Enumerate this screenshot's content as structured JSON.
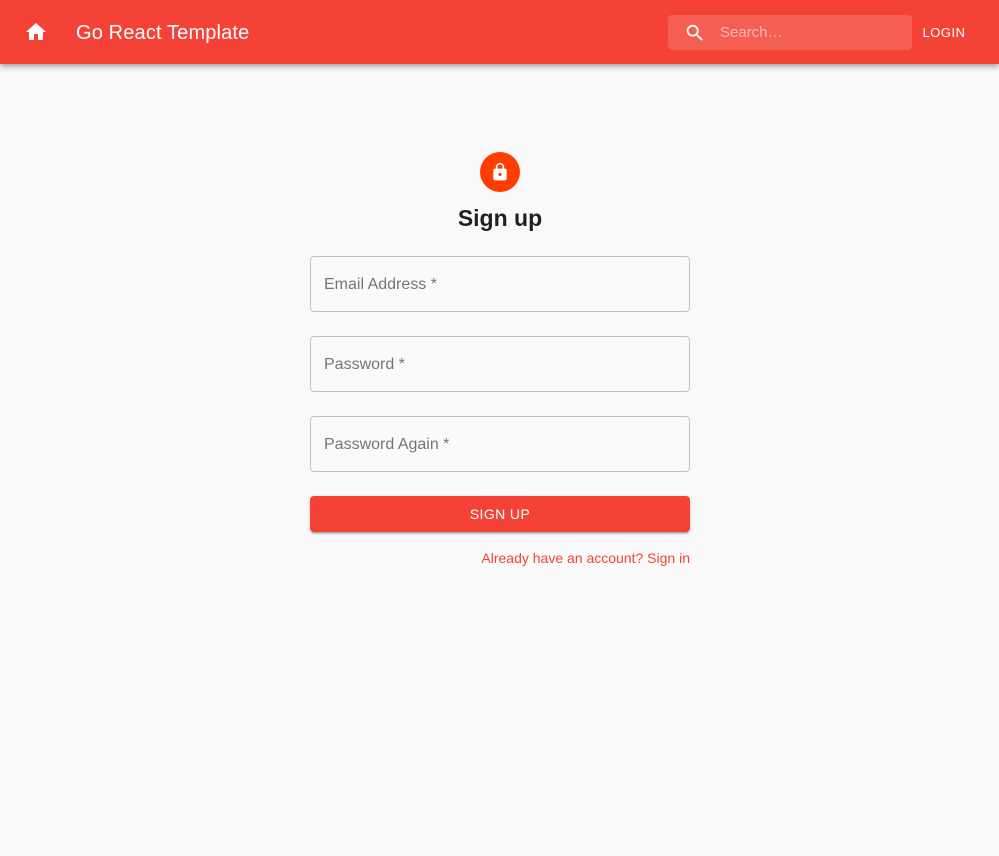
{
  "appbar": {
    "title": "Go React Template",
    "home_icon": "home-icon",
    "search": {
      "placeholder": "Search…",
      "value": "",
      "icon": "search-icon"
    },
    "login_label": "Login",
    "color": "#f44336"
  },
  "form": {
    "avatar_icon": "lock-icon",
    "avatar_color": "#ff3d00",
    "heading": "Sign up",
    "fields": [
      {
        "label": "Email Address *",
        "value": ""
      },
      {
        "label": "Password *",
        "value": ""
      },
      {
        "label": "Password Again *",
        "value": ""
      }
    ],
    "submit_label": "Sign Up",
    "signin_link": "Already have an account? Sign in"
  }
}
